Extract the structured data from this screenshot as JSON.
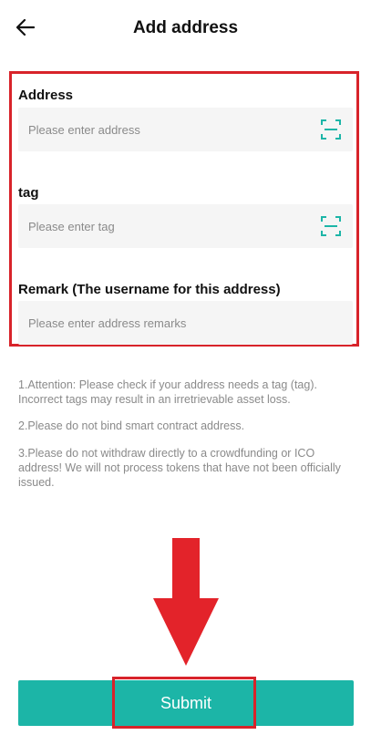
{
  "header": {
    "title": "Add address",
    "back_icon": "arrow-left-icon"
  },
  "form": {
    "address": {
      "label": "Address",
      "placeholder": "Please enter address",
      "value": "",
      "icon": "scan-icon"
    },
    "tag": {
      "label": "tag",
      "placeholder": "Please enter tag",
      "value": "",
      "icon": "scan-icon"
    },
    "remark": {
      "label": "Remark (The username for this address)",
      "placeholder": "Please enter address remarks",
      "value": ""
    }
  },
  "notes": [
    "1.Attention: Please check if your address needs a tag (tag). Incorrect tags may result in an irretrievable asset loss.",
    "2.Please do not bind smart contract address.",
    "3.Please do not withdraw directly to a crowdfunding or ICO address! We will not process tokens that have not been officially issued."
  ],
  "submit": {
    "label": "Submit"
  },
  "colors": {
    "accent": "#1cb5a7",
    "highlight": "#d8232a",
    "field_bg": "#f5f5f5",
    "note_text": "#8a8a8a"
  }
}
